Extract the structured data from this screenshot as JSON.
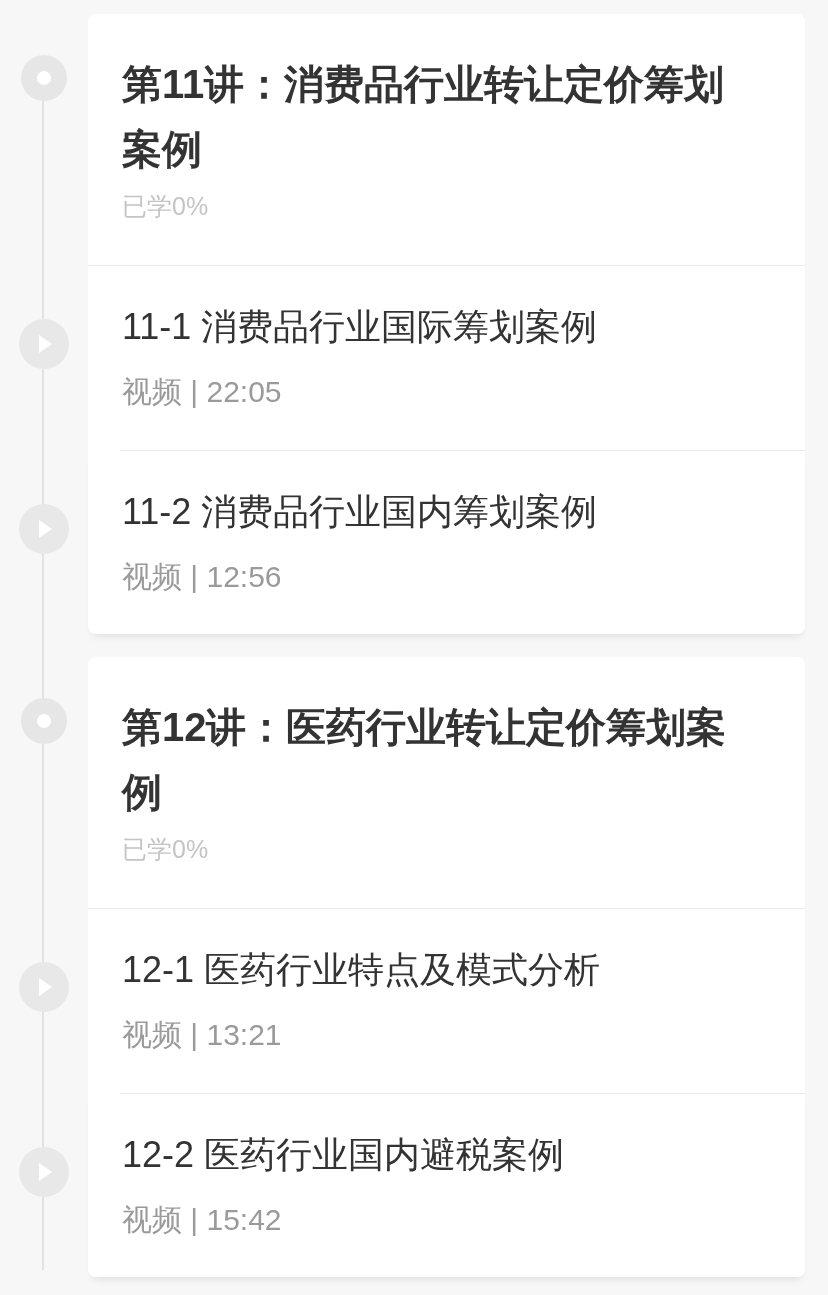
{
  "chapters": [
    {
      "title": "第11讲：消费品行业转让定价筹划案例",
      "progress": "已学0%",
      "lessons": [
        {
          "title": "11-1 消费品行业国际筹划案例",
          "meta": "视频 | 22:05"
        },
        {
          "title": "11-2 消费品行业国内筹划案例",
          "meta": "视频 | 12:56"
        }
      ]
    },
    {
      "title": "第12讲：医药行业转让定价筹划案例",
      "progress": "已学0%",
      "lessons": [
        {
          "title": "12-1 医药行业特点及模式分析",
          "meta": "视频 | 13:21"
        },
        {
          "title": "12-2 医药行业国内避税案例",
          "meta": "视频 | 15:42"
        }
      ]
    }
  ]
}
